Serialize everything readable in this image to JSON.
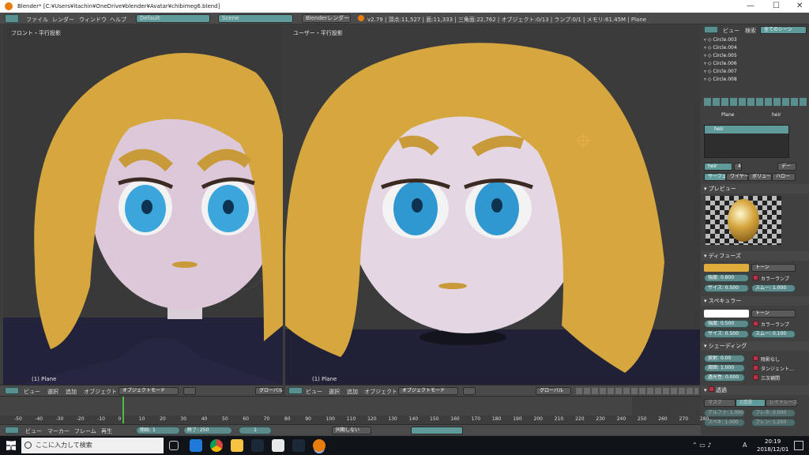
{
  "window": {
    "title": "Blender* [C:¥Users¥itachin¥OneDrive¥blender¥Avatar¥chibimeg6.blend]",
    "controls": [
      "—",
      "☐",
      "✕"
    ]
  },
  "menu": {
    "items": [
      "ファイル",
      "レンダー",
      "ウィンドウ",
      "ヘルプ"
    ],
    "layout": "Default",
    "scene": "Scene",
    "engine": "Blenderレンダー",
    "stats": "v2.79 | 頂点:11,527 | 面:11,333 | 三角面:22,762 | オブジェクト:0/13 | ランプ:0/1 | メモリ:61.45M | Plane"
  },
  "viewports": [
    {
      "label": "フロント・平行投影",
      "object": "(1) Plane",
      "menu": [
        "ビュー",
        "選択",
        "追加",
        "オブジェクト"
      ],
      "mode": "オブジェクトモード",
      "orientation": "グローバル"
    },
    {
      "label": "ユーザー・平行投影",
      "object": "(1) Plane",
      "menu": [
        "ビュー",
        "選択",
        "追加",
        "オブジェクト"
      ],
      "mode": "オブジェクトモード",
      "orientation": "グローバル"
    }
  ],
  "outliner": {
    "tabs": [
      "ビュー",
      "検索",
      "全てのシーン"
    ],
    "items": [
      "Circle.003",
      "Circle.004",
      "Circle.005",
      "Circle.006",
      "Circle.007",
      "Circle.008"
    ]
  },
  "properties": {
    "context_object": "Plane",
    "context_material": "heir",
    "slot": "heir",
    "material_name": "heir",
    "users": "4",
    "data_button": "デー",
    "tabs": [
      "サーフェス",
      "ワイヤー",
      "ボリュー",
      "ハロー"
    ],
    "preview_title": "プレビュー",
    "diffuse": {
      "title": "ディフューズ",
      "shader": "トーン",
      "ramp": "カラーランプ",
      "intensity_label": "強度:",
      "intensity": "0.800",
      "size_label": "サイズ:",
      "size": "0.500",
      "smooth_label": "スムー:",
      "smooth": "1.000",
      "color": "#e0ad3c"
    },
    "specular": {
      "title": "スペキュラー",
      "shader": "トーン",
      "ramp": "カラーランプ",
      "intensity_label": "強度:",
      "intensity": "0.500",
      "size_label": "サイズ:",
      "size": "0.500",
      "smooth_label": "スムー:",
      "smooth": "0.100",
      "color": "#ffffff"
    },
    "shading": {
      "title": "シェーディング",
      "emit_label": "放射:",
      "emit": "0.00",
      "ambient_label": "周囲:",
      "ambient": "1.000",
      "translucency_label": "透光性:",
      "translucency": "0.000",
      "opt1": "陰影なし",
      "opt2": "タンジェント…",
      "opt3": "三次補間"
    },
    "transparency": {
      "title": "透過",
      "modes": [
        "マスク",
        "Z透過",
        "レイトレース"
      ],
      "alpha_label": "アルファ:",
      "alpha": "1.000",
      "fresnel_label": "フレネ:",
      "fresnel": "0.000",
      "specular_label": "スペキ:",
      "specular": "1.000",
      "blend_label": "ブレン:",
      "blend": "1.250"
    }
  },
  "timeline": {
    "ticks": [
      "-50",
      "-40",
      "-30",
      "-20",
      "-10",
      "0",
      "10",
      "20",
      "30",
      "40",
      "50",
      "60",
      "70",
      "80",
      "90",
      "100",
      "110",
      "120",
      "130",
      "140",
      "150",
      "160",
      "170",
      "180",
      "190",
      "200",
      "210",
      "220",
      "230",
      "240",
      "250",
      "260",
      "270",
      "280"
    ],
    "menu": [
      "ビュー",
      "マーカー",
      "フレーム",
      "再生"
    ],
    "start_label": "開始:",
    "start": "1",
    "end_label": "終了:",
    "end": "250",
    "current": "1",
    "sync": "同期しない"
  },
  "taskbar": {
    "search": "ここに入力して検索",
    "time": "20:19",
    "date": "2018/12/01",
    "lang": "A"
  }
}
